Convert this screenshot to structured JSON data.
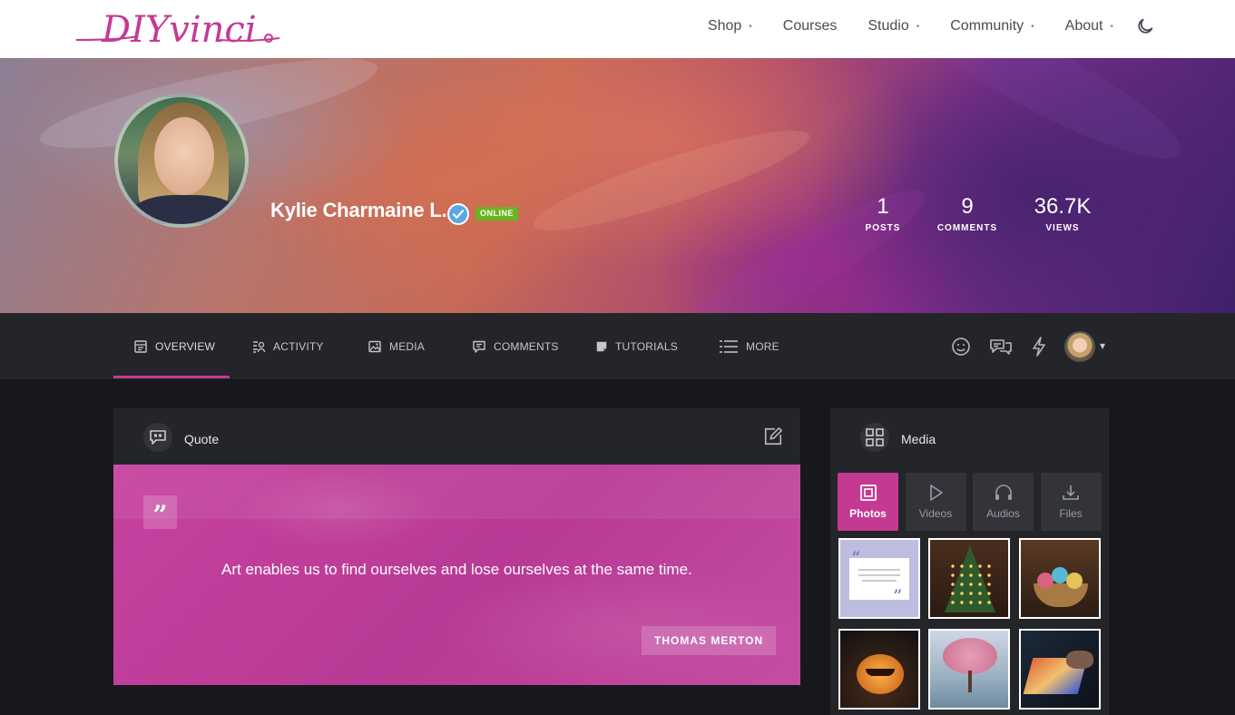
{
  "brand": {
    "logo_text": "DIYvinci",
    "accent": "#c43a93"
  },
  "nav": {
    "items": [
      {
        "label": "Shop",
        "has_menu": true
      },
      {
        "label": "Courses",
        "has_menu": false
      },
      {
        "label": "Studio",
        "has_menu": true
      },
      {
        "label": "Community",
        "has_menu": true
      },
      {
        "label": "About",
        "has_menu": true
      }
    ],
    "caret": "•",
    "theme_toggle": "moon-icon"
  },
  "profile": {
    "name": "Kylie Charmaine L.",
    "status": "ONLINE",
    "verified": true,
    "stats": [
      {
        "value": "1",
        "label": "POSTS"
      },
      {
        "value": "9",
        "label": "COMMENTS"
      },
      {
        "value": "36.7K",
        "label": "VIEWS"
      }
    ]
  },
  "tabs": [
    {
      "label": "OVERVIEW",
      "icon": "overview-icon",
      "active": true
    },
    {
      "label": "ACTIVITY",
      "icon": "activity-icon",
      "active": false
    },
    {
      "label": "MEDIA",
      "icon": "image-icon",
      "active": false
    },
    {
      "label": "COMMENTS",
      "icon": "comment-icon",
      "active": false
    },
    {
      "label": "TUTORIALS",
      "icon": "tutorial-icon",
      "active": false
    },
    {
      "label": "MORE",
      "icon": "more-icon",
      "active": false
    }
  ],
  "toolbar_icons": [
    "smiley-icon",
    "chat-icon",
    "flash-icon"
  ],
  "quote_card": {
    "title": "Quote",
    "quote_mark": "”",
    "text": "Art enables us to find ourselves and lose ourselves at the same time.",
    "author": "THOMAS MERTON"
  },
  "media_card": {
    "title": "Media",
    "tabs": [
      {
        "label": "Photos",
        "icon": "photo-icon",
        "active": true
      },
      {
        "label": "Videos",
        "icon": "play-icon",
        "active": false
      },
      {
        "label": "Audios",
        "icon": "headphones-icon",
        "active": false
      },
      {
        "label": "Files",
        "icon": "download-icon",
        "active": false
      }
    ],
    "thumbnails": [
      {
        "name": "quote-graphic"
      },
      {
        "name": "christmas-tree"
      },
      {
        "name": "yarn-basket"
      },
      {
        "name": "jack-o-lantern"
      },
      {
        "name": "blossom-tree"
      },
      {
        "name": "drawing-tablet"
      }
    ]
  }
}
